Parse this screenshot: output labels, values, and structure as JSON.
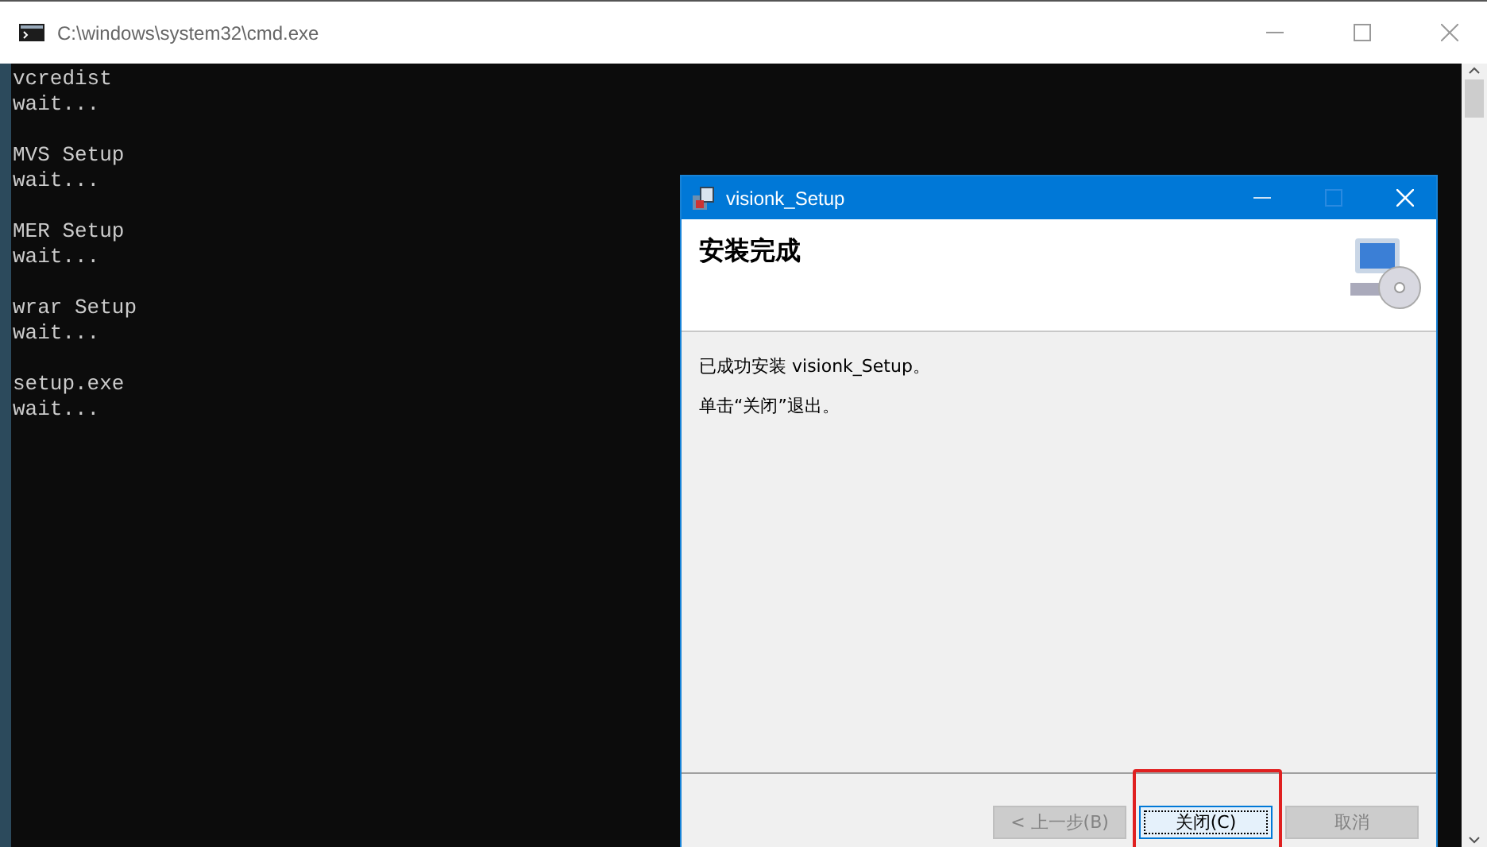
{
  "console_window": {
    "title": "C:\\windows\\system32\\cmd.exe"
  },
  "console": {
    "blocks": [
      {
        "lines": [
          "vcredist",
          "wait..."
        ]
      },
      {
        "lines": [
          "MVS Setup",
          "wait..."
        ]
      },
      {
        "lines": [
          "MER Setup",
          "wait..."
        ]
      },
      {
        "lines": [
          "wrar Setup",
          "wait..."
        ]
      },
      {
        "lines": [
          "setup.exe",
          "wait..."
        ]
      }
    ]
  },
  "dialog": {
    "title": "visionk_Setup",
    "heading": "安装完成",
    "messages": [
      "已成功安装 visionk_Setup。",
      "单击“关闭”退出。"
    ],
    "buttons": [
      {
        "label": "< 上一步(B)",
        "disabled": true,
        "focused": false,
        "highlighted": false
      },
      {
        "label": "关闭(C)",
        "disabled": false,
        "focused": true,
        "highlighted": true
      },
      {
        "label": "取消",
        "disabled": true,
        "focused": false,
        "highlighted": false
      }
    ]
  }
}
